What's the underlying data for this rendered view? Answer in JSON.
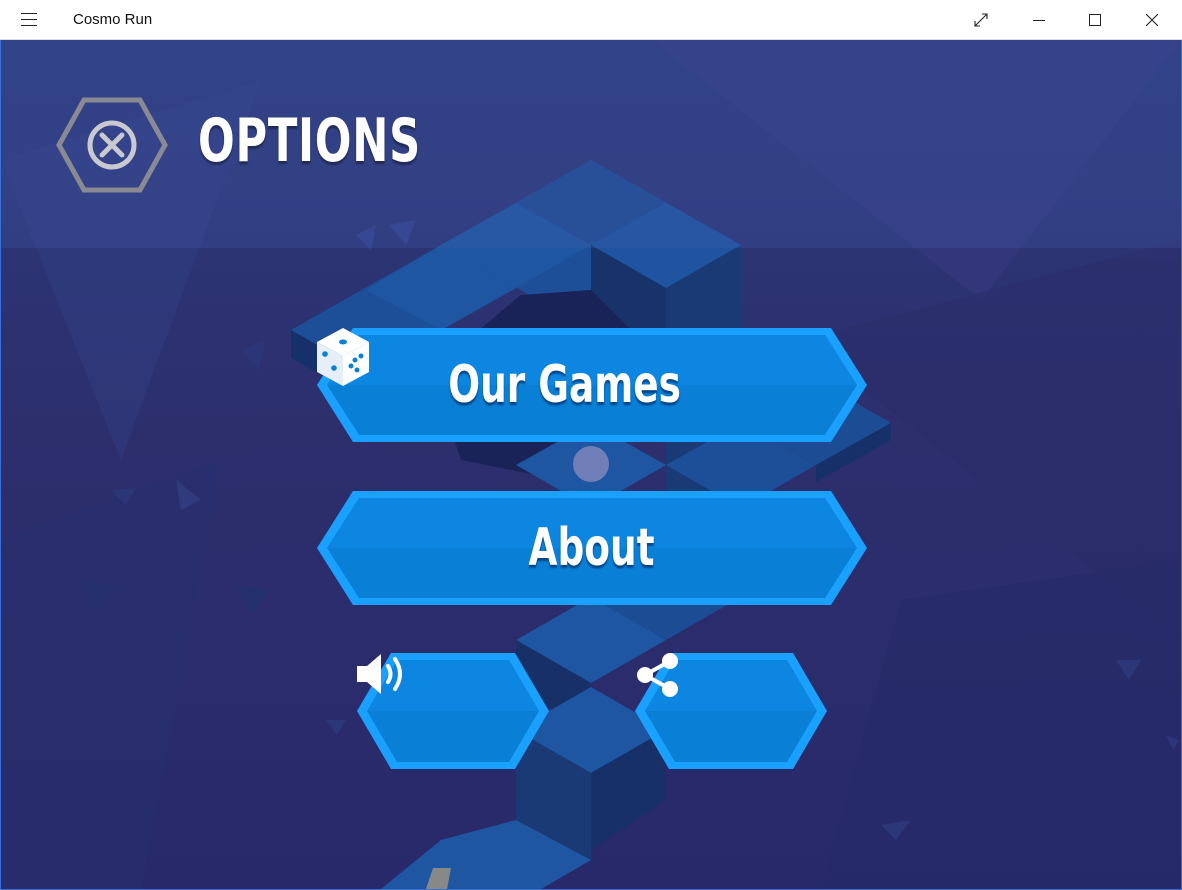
{
  "window": {
    "title": "Cosmo Run",
    "menu_icon": "hamburger-icon",
    "controls": [
      "fullscreen-icon",
      "minimize-icon",
      "maximize-icon",
      "close-icon"
    ]
  },
  "screen": {
    "title": "OPTIONS",
    "close_icon": "close-x-icon"
  },
  "menu": {
    "our_games_label": "Our Games",
    "our_games_icon": "dice-icon",
    "about_label": "About",
    "sound_icon": "speaker-icon",
    "share_icon": "share-icon"
  },
  "colors": {
    "background": "#2b3a7c",
    "button_fill": "#0a84d8",
    "button_border": "#1aa0ff",
    "path_tile": "#1f4f96"
  }
}
